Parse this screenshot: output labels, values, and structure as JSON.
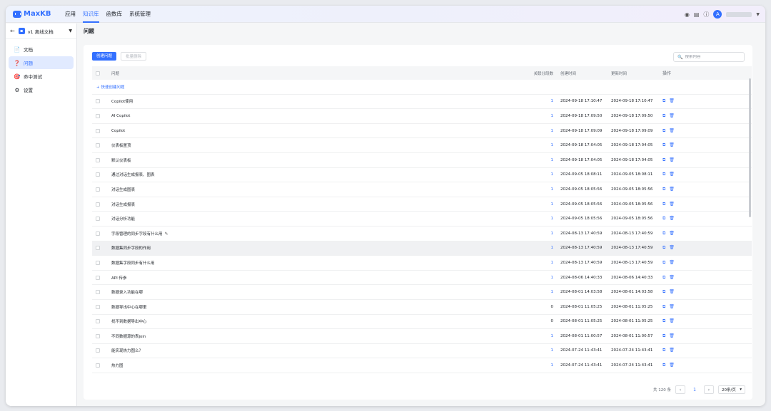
{
  "header": {
    "logo": "MaxKB",
    "nav": [
      {
        "label": "应用",
        "active": false
      },
      {
        "label": "知识库",
        "active": true
      },
      {
        "label": "函数库",
        "active": false
      },
      {
        "label": "系统管理",
        "active": false
      }
    ],
    "icons": [
      "github-icon",
      "document-icon",
      "help-icon"
    ],
    "avatar_initial": "A"
  },
  "sidebar": {
    "kb_name": "v1 离线文档",
    "items": [
      {
        "label": "文档",
        "icon": "📄",
        "active": false
      },
      {
        "label": "问题",
        "icon": "❓",
        "active": true
      },
      {
        "label": "命中测试",
        "icon": "🎯",
        "active": false
      },
      {
        "label": "设置",
        "icon": "⚙",
        "active": false
      }
    ]
  },
  "main": {
    "page_title": "问题",
    "create_button": "创建问题",
    "batch_delete_button": "批量删除",
    "search_placeholder": "搜索内容",
    "quick_create": "+ 快速创建问题",
    "columns": {
      "question": "问题",
      "segments": "关联分段数",
      "created": "创建时间",
      "updated": "更新时间",
      "actions": "操作"
    },
    "rows": [
      {
        "question": "Copilot使用",
        "segments": "1",
        "created": "2024-09-18 17:10:47",
        "updated": "2024-09-18 17:10:47"
      },
      {
        "question": "AI Copilot",
        "segments": "1",
        "created": "2024-09-18 17:09:50",
        "updated": "2024-09-18 17:09:50"
      },
      {
        "question": "Copilot",
        "segments": "1",
        "created": "2024-09-18 17:09:09",
        "updated": "2024-09-18 17:09:09"
      },
      {
        "question": "仪表板置顶",
        "segments": "1",
        "created": "2024-09-18 17:04:05",
        "updated": "2024-09-18 17:04:05"
      },
      {
        "question": "默认仪表板",
        "segments": "1",
        "created": "2024-09-18 17:04:05",
        "updated": "2024-09-18 17:04:05"
      },
      {
        "question": "通过对话生成报表、图表",
        "segments": "1",
        "created": "2024-09-05 18:08:11",
        "updated": "2024-09-05 18:08:11"
      },
      {
        "question": "对话生成图表",
        "segments": "1",
        "created": "2024-09-05 18:05:56",
        "updated": "2024-09-05 18:05:56"
      },
      {
        "question": "对话生成报表",
        "segments": "1",
        "created": "2024-09-05 18:05:56",
        "updated": "2024-09-05 18:05:56"
      },
      {
        "question": "对话分析功能",
        "segments": "1",
        "created": "2024-09-05 18:05:56",
        "updated": "2024-09-05 18:05:56"
      },
      {
        "question": "字段管理的同步字段有什么用",
        "segments": "1",
        "created": "2024-08-13 17:40:59",
        "updated": "2024-08-13 17:40:59",
        "edit": true
      },
      {
        "question": "数据集同步字段的作用",
        "segments": "1",
        "created": "2024-08-13 17:40:59",
        "updated": "2024-08-13 17:40:59",
        "highlight": true
      },
      {
        "question": "数据集字段同步有什么用",
        "segments": "1",
        "created": "2024-08-13 17:40:59",
        "updated": "2024-08-13 17:40:59"
      },
      {
        "question": "API 传参",
        "segments": "1",
        "created": "2024-08-06 14:40:33",
        "updated": "2024-08-06 14:40:33"
      },
      {
        "question": "数据录入功能在哪",
        "segments": "1",
        "created": "2024-08-01 14:03:58",
        "updated": "2024-08-01 14:03:58"
      },
      {
        "question": "数据导出中心在哪里",
        "segments": "0",
        "created": "2024-08-01 11:05:25",
        "updated": "2024-08-01 11:05:25"
      },
      {
        "question": "找不到数据导出中心",
        "segments": "0",
        "created": "2024-08-01 11:05:25",
        "updated": "2024-08-01 11:05:25"
      },
      {
        "question": "不同数据源的表join",
        "segments": "1",
        "created": "2024-08-01 11:00:57",
        "updated": "2024-08-01 11:00:57"
      },
      {
        "question": "能实现热力图么？",
        "segments": "1",
        "created": "2024-07-24 11:43:41",
        "updated": "2024-07-24 11:43:41"
      },
      {
        "question": "热力图",
        "segments": "1",
        "created": "2024-07-24 11:43:41",
        "updated": "2024-07-24 11:43:41"
      }
    ],
    "footer": {
      "total": "共 120 条",
      "current_page": "1",
      "page_size": "20条/页"
    }
  }
}
